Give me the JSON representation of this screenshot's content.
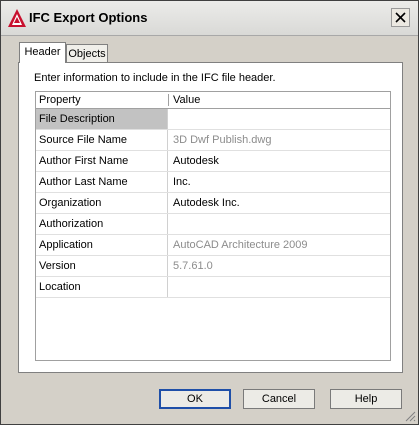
{
  "window": {
    "title": "IFC Export Options"
  },
  "tabs": [
    {
      "label": "Header",
      "active": true
    },
    {
      "label": "Objects",
      "active": false
    }
  ],
  "panel": {
    "instructions": "Enter information to include in the IFC file header."
  },
  "grid": {
    "columns": [
      "Property",
      "Value"
    ],
    "rows": [
      {
        "property": "File Description",
        "value": "",
        "editable": true
      },
      {
        "property": "Source File Name",
        "value": "3D Dwf Publish.dwg",
        "editable": false
      },
      {
        "property": "Author First Name",
        "value": "Autodesk",
        "editable": true
      },
      {
        "property": "Author Last Name",
        "value": "Inc.",
        "editable": true
      },
      {
        "property": "Organization",
        "value": "Autodesk Inc.",
        "editable": true
      },
      {
        "property": "Authorization",
        "value": "",
        "editable": true
      },
      {
        "property": "Application",
        "value": "AutoCAD Architecture 2009",
        "editable": false
      },
      {
        "property": "Version",
        "value": "5.7.61.0",
        "editable": false
      },
      {
        "property": "Location",
        "value": "",
        "editable": true
      }
    ]
  },
  "buttons": {
    "ok": "OK",
    "cancel": "Cancel",
    "help": "Help"
  },
  "colors": {
    "accent": "#1f4fa8",
    "selected_row": "#c2c2c2",
    "readonly_text": "#8c8c8c",
    "logo_red": "#c8102e"
  }
}
